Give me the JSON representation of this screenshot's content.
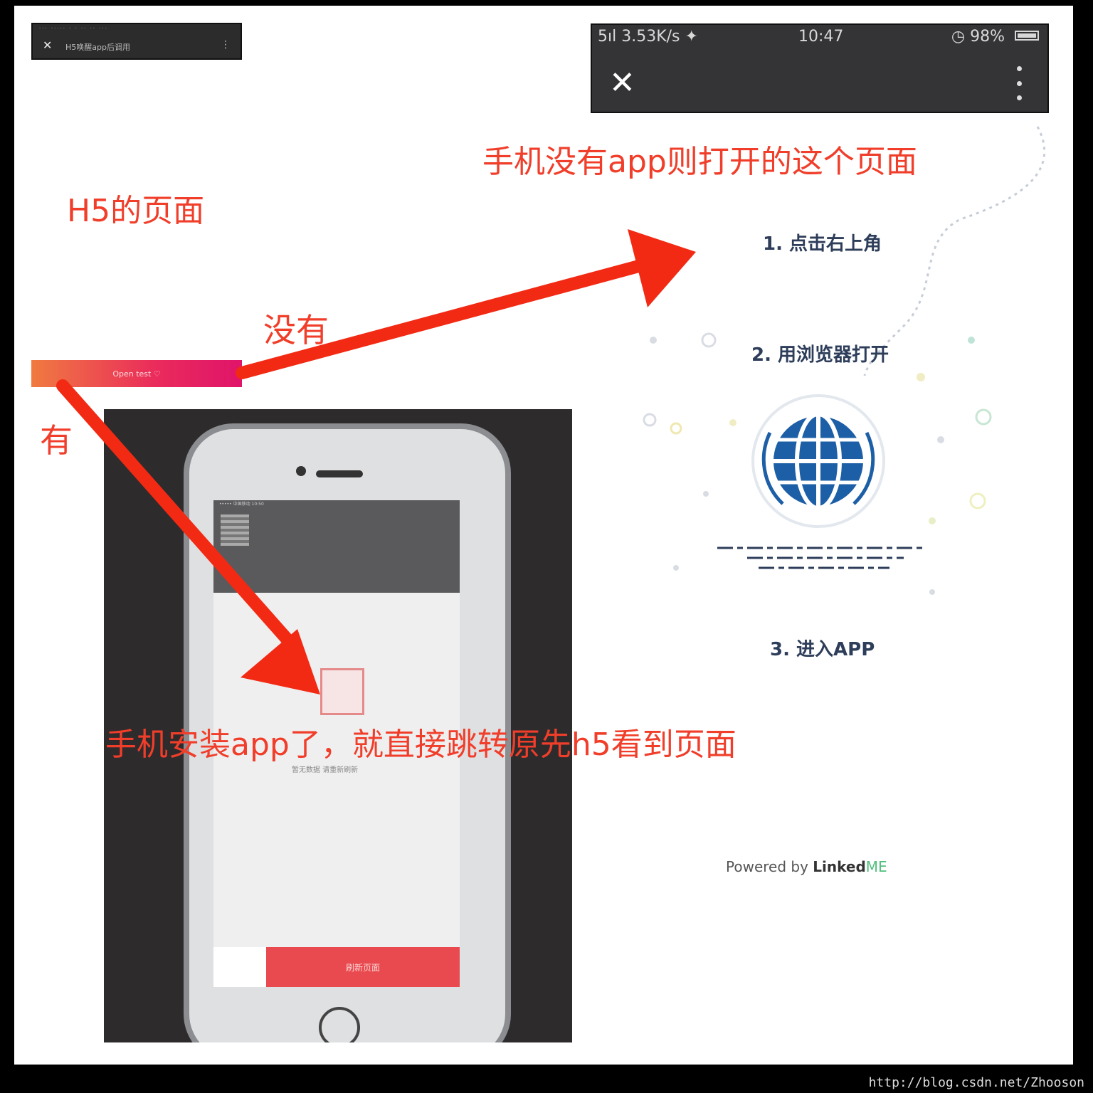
{
  "mini_bar": {
    "status": "··· ·····  ·  · ··  ·· ···",
    "close": "✕",
    "title": "H5唤醒app后调用",
    "more": "⋮"
  },
  "labels": {
    "h5_page": "H5的页面",
    "no": "没有",
    "yes": "有",
    "no_app_page": "手机没有app则打开的这个页面",
    "has_app": "手机安装app了，就直接跳转原先h5看到页面"
  },
  "h5_button": {
    "label": "Open test ♡"
  },
  "right_header": {
    "signal": "5ıl 3.53K/s ✦",
    "time": "10:47",
    "battery_text": "◷ 98%",
    "close": "✕"
  },
  "steps": [
    "1. 点击右上角",
    "2. 用浏览器打开",
    "3. 进入APP"
  ],
  "powered": {
    "prefix": "Powered by",
    "brand": "Linked",
    "brand_suffix": "ME"
  },
  "phone_screen": {
    "status": "••••• 中国移动  10:50",
    "empty_text": "暂无数据  请重新刷新",
    "footer_button": "刷新页面"
  },
  "watermark": "http://blog.csdn.net/Zhooson",
  "colors": {
    "annotation_red": "#f03e2a",
    "arrow_red": "#f22a14",
    "globe_blue": "#1d5fa6",
    "step_text": "#2d3d5a"
  },
  "icons": [
    "close-icon",
    "more-icon",
    "globe-icon",
    "battery-icon",
    "grid-icon",
    "empty-state-icon"
  ]
}
